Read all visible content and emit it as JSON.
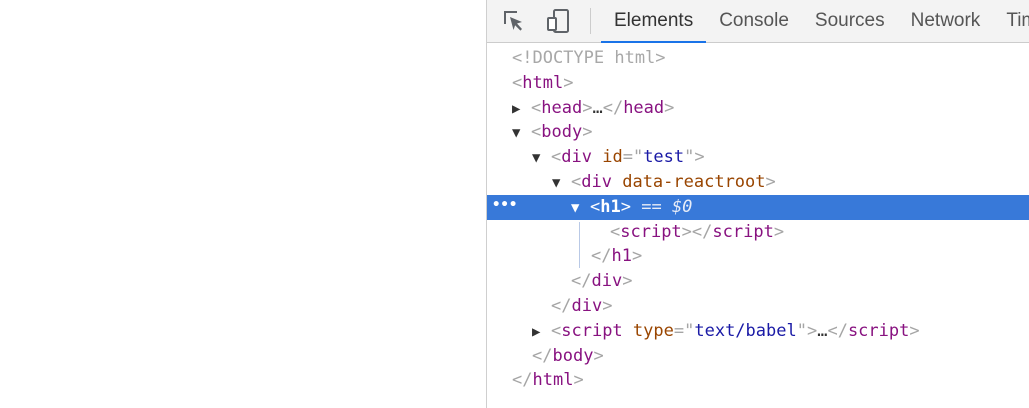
{
  "toolbar": {
    "inspect_icon": "inspect-element-icon",
    "device_icon": "device-toolbar-icon",
    "tabs": [
      {
        "label": "Elements",
        "active": true
      },
      {
        "label": "Console"
      },
      {
        "label": "Sources"
      },
      {
        "label": "Network"
      },
      {
        "label": "Timing"
      }
    ]
  },
  "colors": {
    "tag": "#881280",
    "attr_name": "#994500",
    "attr_value": "#1a1aa6",
    "selected_row": "#3879d9",
    "active_tab_underline": "#1a73e8"
  },
  "tree": {
    "doctype": "<!DOCTYPE html>",
    "html_tag": "html",
    "head_tag": "head",
    "ellipsis": "…",
    "body_tag": "body",
    "div_tag": "div",
    "div_attr_name": "id",
    "div_attr_value": "test",
    "inner_div_attr": "data-reactroot",
    "h1_tag": "h1",
    "selected_marker": "== $0",
    "row_menu": "•••",
    "script_tag": "script",
    "script_attr_name": "type",
    "script_attr_value": "text/babel"
  }
}
